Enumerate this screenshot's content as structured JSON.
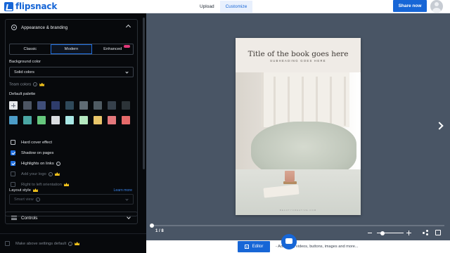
{
  "app": {
    "brand": "flipsnack",
    "tabs": [
      {
        "label": "Upload"
      },
      {
        "label": "Customize",
        "active": true
      }
    ],
    "share_label": "Share now",
    "accent": "#1766d6"
  },
  "sidebar": {
    "section_title": "Appearance & branding",
    "modes": [
      {
        "label": "Classic"
      },
      {
        "label": "Modern",
        "selected": true
      },
      {
        "label": "Enhanced",
        "badge": true
      }
    ],
    "background_color_label": "Background color",
    "background_select_value": "Solid colors",
    "team_colors_label": "Team colors",
    "default_palette_label": "Default palette",
    "palette_row1": [
      "#e7e9ec",
      "#4c5563",
      "#3f4e79",
      "#2e3c6b",
      "#2f495a",
      "#5f6b74",
      "#4f5b63",
      "#36404b",
      "#2c3338"
    ],
    "palette_row2": [
      "#4c9cc7",
      "#4aa6a3",
      "#66c77d",
      "#dadde0",
      "#a9e8e6",
      "#b4e8c0",
      "#e8c56a",
      "#e3787c",
      "#e66a6a"
    ],
    "checkboxes": [
      {
        "label": "Hard cover effect",
        "checked": false,
        "info": false,
        "crown": false,
        "disabled": false
      },
      {
        "label": "Shadow on pages",
        "checked": true,
        "info": false,
        "crown": false,
        "disabled": false
      },
      {
        "label": "Highlights on links",
        "checked": true,
        "info": true,
        "crown": false,
        "disabled": false
      },
      {
        "label": "Add your logo",
        "checked": false,
        "info": true,
        "crown": true,
        "disabled": true
      },
      {
        "label": "Right to left orientation",
        "checked": false,
        "info": false,
        "crown": true,
        "disabled": true
      }
    ],
    "layout_style_label": "Layout style",
    "learn_more_label": "Learn more",
    "layout_select_value": "Smart view",
    "controls_label": "Controls",
    "make_default_label": "Make above settings default"
  },
  "viewer": {
    "book_title": "Title of the book goes here",
    "book_subheading": "SUBHEADING GOES HERE",
    "book_footer": "BEAUTYCREATIVE.COM",
    "page_indicator": "1 / 8",
    "progress_fraction": 0,
    "zoom_fraction": 0.2
  },
  "bottom": {
    "editor_label": "Editor",
    "hint": "- Add links, videos, buttons, images and more..."
  }
}
